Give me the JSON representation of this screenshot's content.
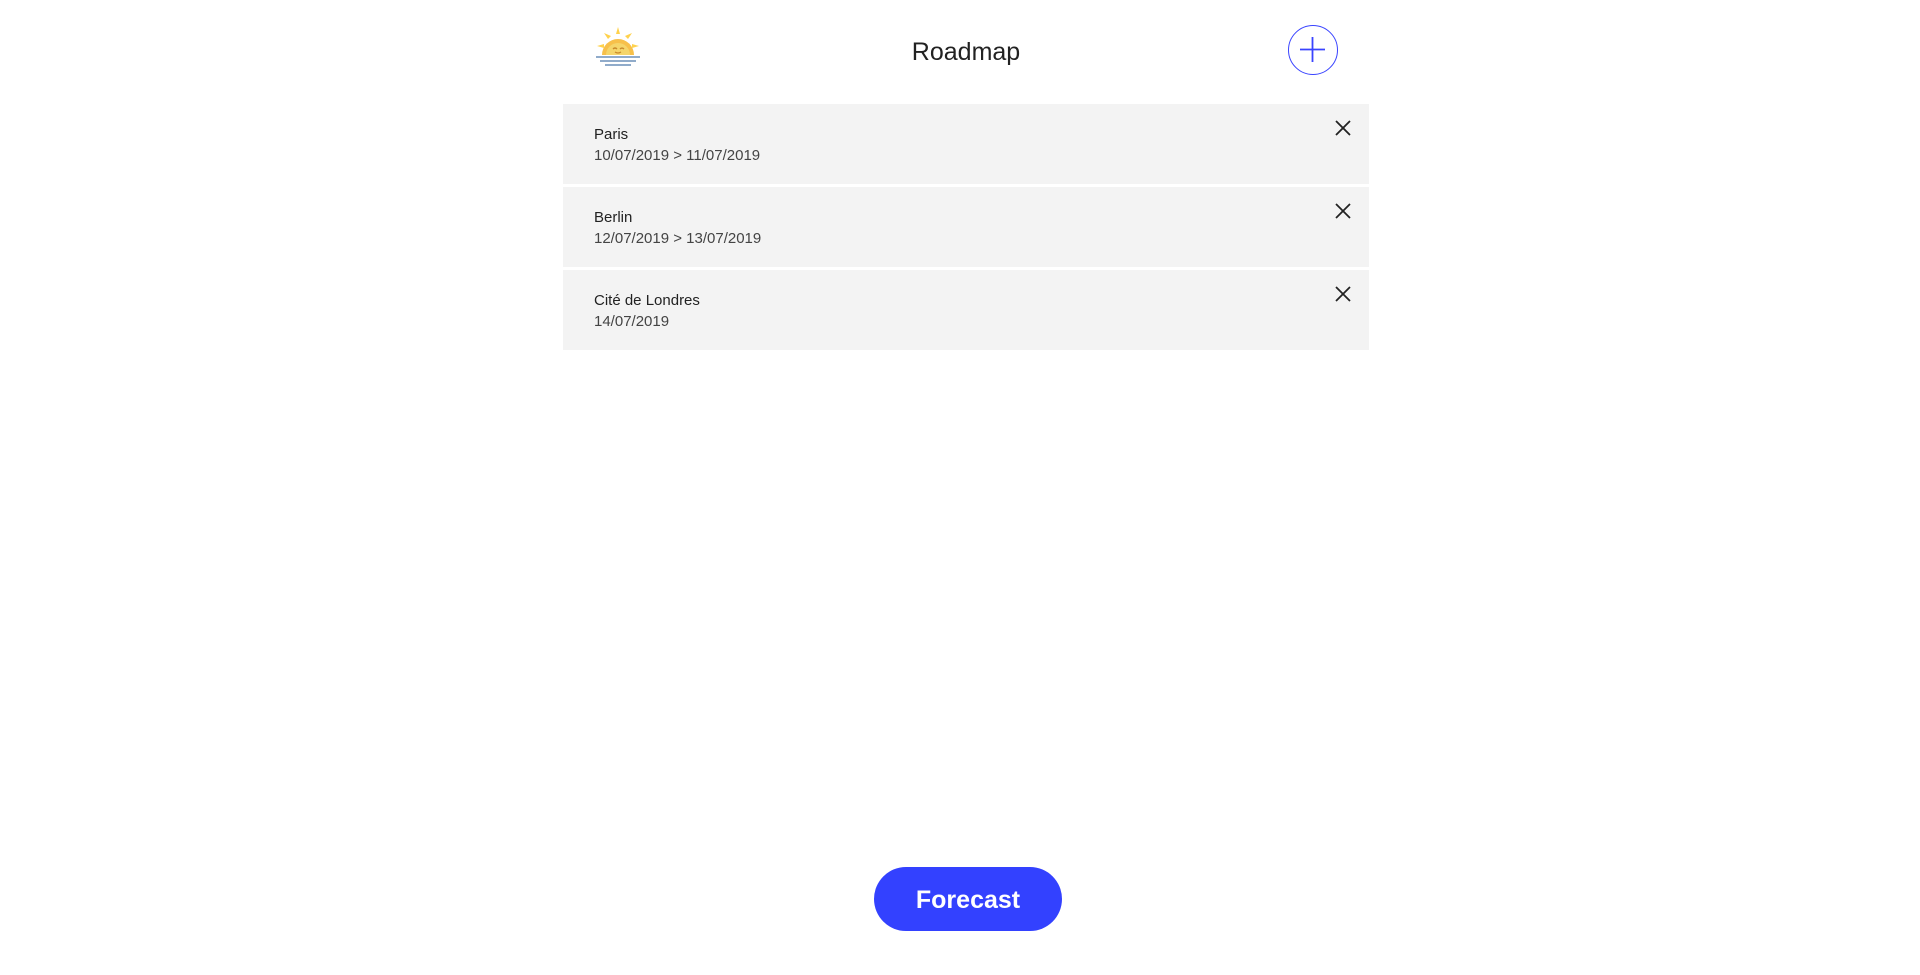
{
  "header": {
    "title": "Roadmap",
    "logo_icon": "sun-over-water-icon",
    "add_icon": "plus-icon"
  },
  "roadmap": {
    "items": [
      {
        "name": "Paris",
        "dates": "10/07/2019 > 11/07/2019",
        "remove_icon": "close-icon"
      },
      {
        "name": "Berlin",
        "dates": "12/07/2019 > 13/07/2019",
        "remove_icon": "close-icon"
      },
      {
        "name": "Cité de Londres",
        "dates": "14/07/2019",
        "remove_icon": "close-icon"
      }
    ]
  },
  "footer": {
    "forecast_label": "Forecast"
  },
  "colors": {
    "accent": "#3341ff",
    "item_background": "#f3f3f3",
    "text": "#222222"
  }
}
